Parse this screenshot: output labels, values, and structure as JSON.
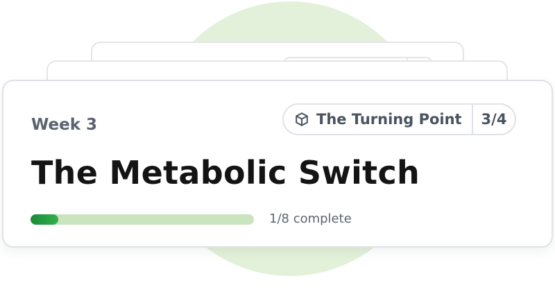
{
  "card": {
    "week_label": "Week 3",
    "title": "The Metabolic Switch",
    "chapter": {
      "icon": "cube-icon",
      "name": "The Turning Point",
      "count": "3/4"
    },
    "progress": {
      "completed": 1,
      "total": 8,
      "fraction": 0.125,
      "label": "1/8 complete"
    }
  },
  "colors": {
    "accent_green": "#1a8a3a",
    "track_green": "#c9e4bf",
    "background_circle": "#e3f1da",
    "title_text": "#141414",
    "muted_text": "#5a6270",
    "border": "#dfe2e6"
  }
}
